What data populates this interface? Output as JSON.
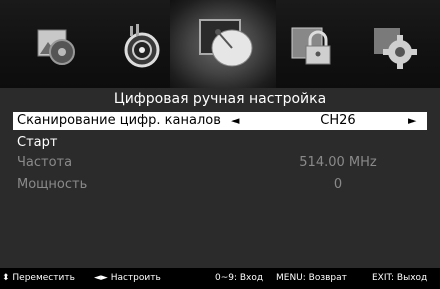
{
  "menu": {
    "title": "Цифровая ручная настройка",
    "icons": [
      {
        "name": "picture-icon"
      },
      {
        "name": "audio-speaker-icon"
      },
      {
        "name": "satellite-dish-icon",
        "selected": true
      },
      {
        "name": "lock-icon"
      },
      {
        "name": "gear-settings-icon"
      }
    ]
  },
  "rows": {
    "scan": {
      "label": "Сканирование цифр. каналов",
      "value": "CH26",
      "left_arrow": "◄",
      "right_arrow": "►"
    },
    "start": {
      "label": "Старт"
    },
    "frequency": {
      "label": "Частота",
      "value": "514.00 MHz"
    },
    "power": {
      "label": "Мощность",
      "value": "0"
    }
  },
  "help": {
    "move": "⬍ Переместить",
    "adjust": "◄► Настроить",
    "enter": "0~9: Вход",
    "back": "MENU: Возврат",
    "exit": "EXIT: Выход"
  },
  "colors": {
    "menu_background": "#2b2b2b",
    "selected_row": "#ffffff",
    "disabled_text": "#8a8a8a"
  }
}
